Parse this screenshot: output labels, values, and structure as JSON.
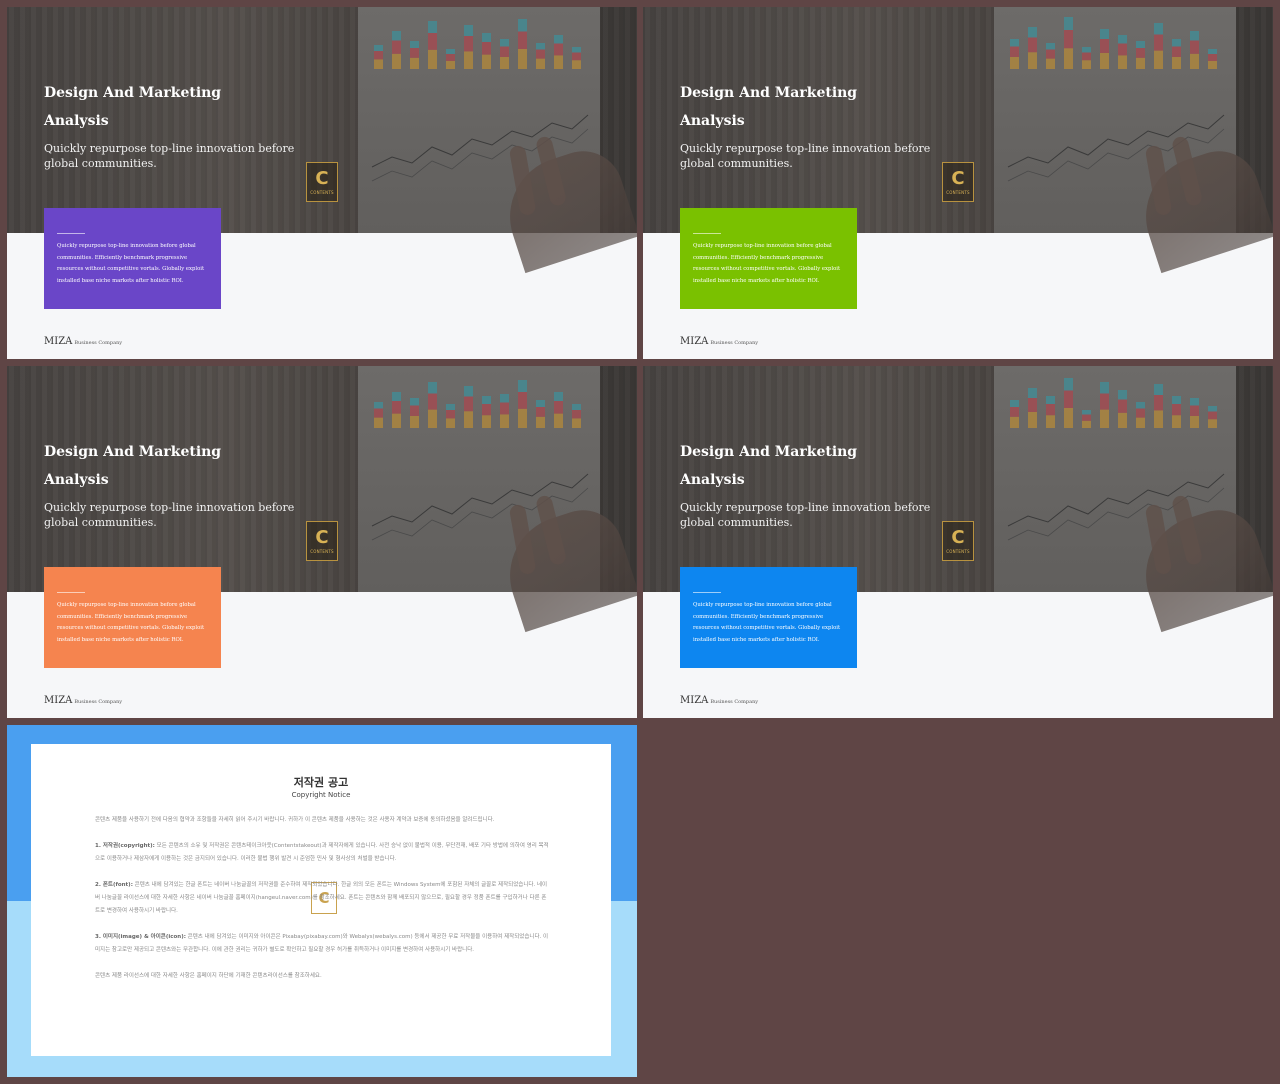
{
  "slides": [
    {
      "title_line1": "Design And Marketing",
      "title_line2": "Analysis",
      "subtitle": "Quickly repurpose top-line innovation before global communities.",
      "card_text": "Quickly repurpose top-line innovation before global communities. Efficiently benchmark progressive resources without competitive vortals. Globally exploit installed base niche markets after holistic ROI.",
      "card_color": "#6a46c8",
      "brand": "MIZA",
      "brand_sub": "Business Company",
      "logo_letter": "C",
      "logo_text": "CONTENTS"
    },
    {
      "title_line1": "Design And Marketing",
      "title_line2": "Analysis",
      "subtitle": "Quickly repurpose top-line innovation before global communities.",
      "card_text": "Quickly repurpose top-line innovation before global communities. Efficiently benchmark progressive resources without competitive vortals. Globally exploit installed base niche markets after holistic ROI.",
      "card_color": "#7ac100",
      "brand": "MIZA",
      "brand_sub": "Business Company",
      "logo_letter": "C",
      "logo_text": "CONTENTS"
    },
    {
      "title_line1": "Design And Marketing",
      "title_line2": "Analysis",
      "subtitle": "Quickly repurpose top-line innovation before global communities.",
      "card_text": "Quickly repurpose top-line innovation before global communities. Efficiently benchmark progressive resources without competitive vortals. Globally exploit installed base niche markets after holistic ROI.",
      "card_color": "#f5844f",
      "brand": "MIZA",
      "brand_sub": "Business Company",
      "logo_letter": "C",
      "logo_text": "CONTENTS"
    },
    {
      "title_line1": "Design And Marketing",
      "title_line2": "Analysis",
      "subtitle": "Quickly repurpose top-line innovation before global communities.",
      "card_text": "Quickly repurpose top-line innovation before global communities. Efficiently benchmark progressive resources without competitive vortals. Globally exploit installed base niche markets after holistic ROI.",
      "card_color": "#0d86f0",
      "brand": "MIZA",
      "brand_sub": "Business Company",
      "logo_letter": "C",
      "logo_text": "CONTENTS"
    }
  ],
  "notice": {
    "title": "저작권 공고",
    "subtitle": "Copyright Notice",
    "intro": "콘텐츠 제품을 사용하기 전에 다음의 협약과 조항들을 자세히 읽어 주시기 바랍니다. 귀하가 이 콘텐츠 제품을 사용하는 것은 사용자 계약과 보증에 동의하셨음을 알려드립니다.",
    "s1_head": "1. 저작권(copyright):",
    "s1_body": "모든 콘텐츠의 소유 및 저작권은 콘텐츠테이크아웃(Contentstakeout)과 제작자에게 있습니다. 사전 승낙 없이 불법적 이용, 무단전재, 배포 기타 방법에 의하여 영리 목적으로 이용하거나 제삼자에게 이용하는 것은 금지되어 있습니다. 이러한 불법 행위 발견 시 준엄한 민사 및 형사상의 처벌을 받습니다.",
    "s2_head": "2. 폰트(font):",
    "s2_body": "콘텐츠 내에 담겨있는 한글 폰트는 네이버 나눔글꼴의 저작권을 준수하여 제작되었습니다. 한글 외의 모든 폰트는 Windows System에 포함된 자체의 글꼴로 제작되었습니다. 네이버 나눔글꼴 라이선스에 대한 자세한 사항은 네이버 나눔글꼴 홈페이지(hangeul.naver.com)를 참조하세요. 폰트는 콘텐츠와 함께 배포되지 않으므로, 필요할 경우 정품 폰트를 구입하거나 다른 폰트로 변경하여 사용하시기 바랍니다.",
    "s3_head": "3. 이미지(image) & 아이콘(icon):",
    "s3_body": "콘텐츠 내에 담겨있는 이미지와 아이콘은 Pixabay(pixabay.com)와 Webalys(webalys.com) 등에서 제공한 무료 저작물을 이용하여 제작되었습니다. 이미지는 참고로만 제공되고 콘텐츠와는 무관합니다. 이에 관한 권리는 귀하가 별도로 확인하고 필요할 경우 허가를 취득하거나 이미지를 변경하여 사용하시기 바랍니다.",
    "footer": "콘텐츠 제품 라이선스에 대한 자세한 사항은 홈페이지 하단에 기재한 콘텐츠라이선스를 참조하세요.",
    "watermark": "C",
    "colors": {
      "top": "#4a9ff0",
      "bottom": "#a6dcfa"
    }
  }
}
